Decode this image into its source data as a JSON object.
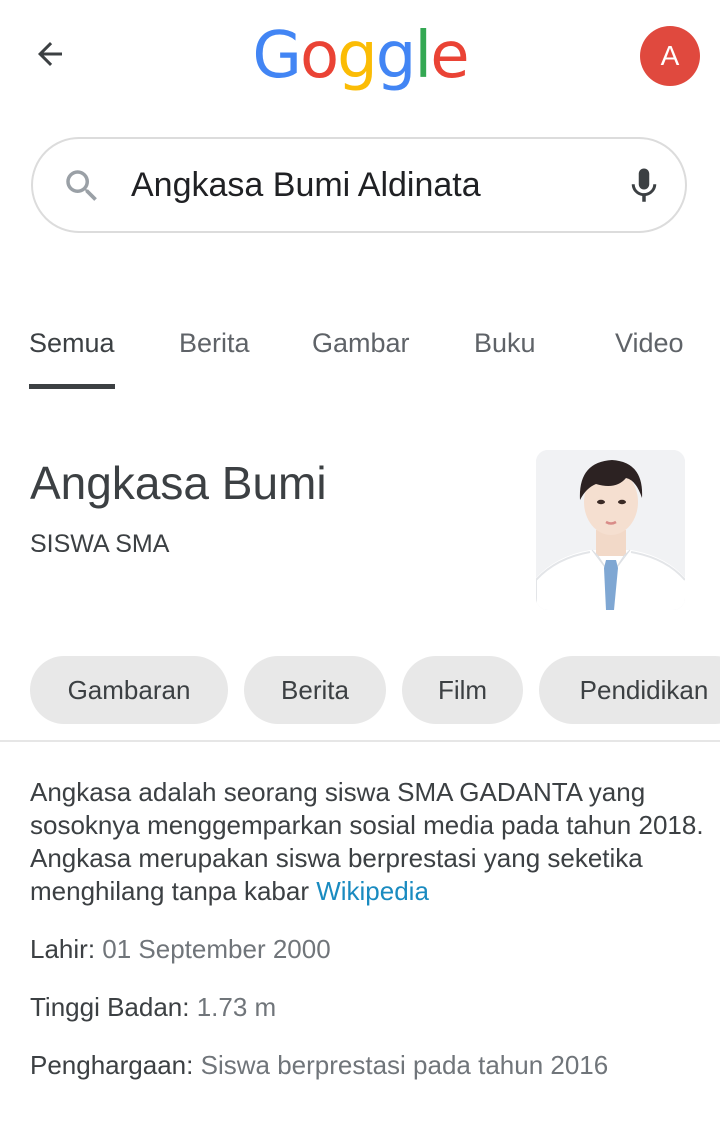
{
  "header": {
    "logo_letters": [
      "G",
      "o",
      "g",
      "g",
      "l",
      "e"
    ],
    "logo_colors": [
      "#4285F4",
      "#EA4335",
      "#FBBC05",
      "#4285F4",
      "#34A853",
      "#EA4335"
    ],
    "avatar_letter": "A",
    "avatar_color": "#E0493E"
  },
  "search": {
    "query": "Angkasa Bumi Aldinata"
  },
  "tabs": [
    "Semua",
    "Berita",
    "Gambar",
    "Buku",
    "Video"
  ],
  "entity": {
    "title": "Angkasa Bumi",
    "subtitle": "SISWA SMA"
  },
  "chips": [
    "Gambaran",
    "Berita",
    "Film",
    "Pendidikan"
  ],
  "description": {
    "text": "Angkasa adalah seorang siswa SMA GADANTA yang sosoknya menggemparkan sosial media pada tahun 2018. Angkasa merupakan siswa berprestasi yang seketika menghilang tanpa kabar ",
    "source_link": "Wikipedia"
  },
  "facts": [
    {
      "label": "Lahir:",
      "value": "01 September 2000"
    },
    {
      "label": "Tinggi Badan:",
      "value": "1.73 m"
    },
    {
      "label": "Penghargaan:",
      "value": "Siswa berprestasi pada tahun 2016"
    }
  ],
  "colors": {
    "link": "#1A8BC0",
    "tie": "#7FA7D3"
  }
}
